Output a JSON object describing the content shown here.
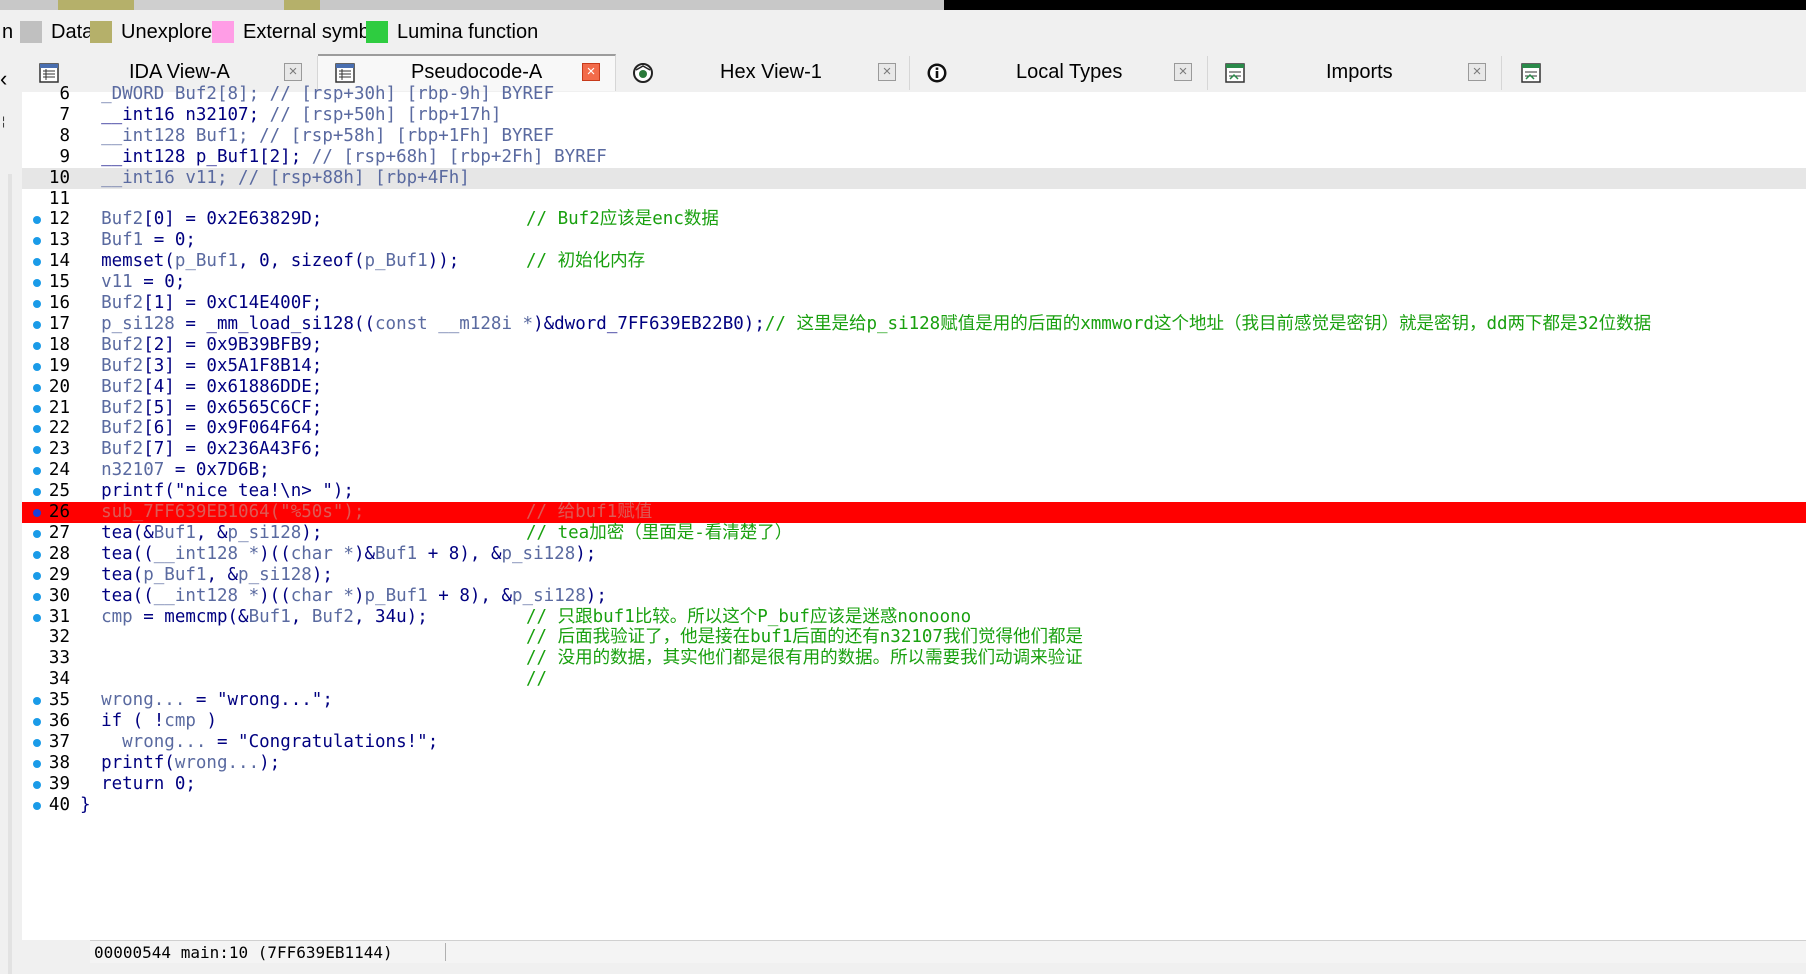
{
  "legend": [
    {
      "label": "n",
      "color": ""
    },
    {
      "label": "Data",
      "color": "#c0c0c0"
    },
    {
      "label": "Unexplored",
      "color": "#b5b06a"
    },
    {
      "label": "External symbol",
      "color": "#ff9de6"
    },
    {
      "label": "Lumina function",
      "color": "#2ecc40"
    }
  ],
  "tabs": [
    {
      "label": "IDA View-A",
      "icon": "grid-icon",
      "active": false
    },
    {
      "label": "Pseudocode-A",
      "icon": "grid-icon",
      "active": true
    },
    {
      "label": "Hex View-1",
      "icon": "hex-icon",
      "active": false
    },
    {
      "label": "Local Types",
      "icon": "info-icon",
      "active": false
    },
    {
      "label": "Imports",
      "icon": "imports-icon",
      "active": false
    }
  ],
  "code_lines": [
    {
      "no": "6",
      "bp": false,
      "tokens": [
        [
          "  _DWORD Buf2[8]; ",
          "t-dim"
        ],
        [
          "// [rsp+30h] [rbp-9h] BYREF",
          "t-dim"
        ]
      ]
    },
    {
      "no": "7",
      "bp": false,
      "tokens": [
        [
          "  __int16 n32107; ",
          "t-kw"
        ],
        [
          "// [rsp+50h] [rbp+17h]",
          "t-dim"
        ]
      ]
    },
    {
      "no": "8",
      "bp": false,
      "tokens": [
        [
          "  __int128 Buf1; ",
          "t-dim"
        ],
        [
          "// [rsp+58h] [rbp+1Fh] BYREF",
          "t-dim"
        ]
      ]
    },
    {
      "no": "9",
      "bp": false,
      "tokens": [
        [
          "  __int128 p_Buf1[2]; ",
          "t-kw"
        ],
        [
          "// [rsp+68h] [rbp+2Fh] BYREF",
          "t-dim"
        ]
      ]
    },
    {
      "no": "10",
      "bp": false,
      "current": true,
      "tokens": [
        [
          "  __int16 v11; ",
          "t-dim"
        ],
        [
          "// [rsp+88h] [rbp+4Fh]",
          "t-dim"
        ]
      ]
    },
    {
      "no": "11",
      "bp": false,
      "tokens": []
    },
    {
      "no": "12",
      "bp": true,
      "tokens": [
        [
          "  Buf2",
          "t-var"
        ],
        [
          "[0] = 0x2E63829D;",
          "t-kw"
        ]
      ],
      "comment": "// Buf2应该是enc数据"
    },
    {
      "no": "13",
      "bp": true,
      "tokens": [
        [
          "  Buf1",
          "t-var"
        ],
        [
          " = 0;",
          "t-kw"
        ]
      ]
    },
    {
      "no": "14",
      "bp": true,
      "tokens": [
        [
          "  memset(",
          "t-kw"
        ],
        [
          "p_Buf1",
          "t-var"
        ],
        [
          ", 0, sizeof(",
          "t-kw"
        ],
        [
          "p_Buf1",
          "t-var"
        ],
        [
          "));",
          "t-kw"
        ]
      ],
      "comment": "// 初始化内存"
    },
    {
      "no": "15",
      "bp": true,
      "tokens": [
        [
          "  v11",
          "t-var"
        ],
        [
          " = 0;",
          "t-kw"
        ]
      ]
    },
    {
      "no": "16",
      "bp": true,
      "tokens": [
        [
          "  Buf2",
          "t-var"
        ],
        [
          "[1] = 0xC14E400F;",
          "t-kw"
        ]
      ]
    },
    {
      "no": "17",
      "bp": true,
      "tokens": [
        [
          "  p_si128",
          "t-var"
        ],
        [
          " = _mm_load_si128((",
          "t-kw"
        ],
        [
          "const __m128i *",
          "t-dim"
        ],
        [
          ")&dword_7FF639EB22B0);",
          "t-kw"
        ],
        [
          "// 这里是给p_si128赋值是用的后面的xmmword这个地址（我目前感觉是密钥）就是密钥，dd两下都是32位数据",
          "t-cmt"
        ]
      ]
    },
    {
      "no": "18",
      "bp": true,
      "tokens": [
        [
          "  Buf2",
          "t-var"
        ],
        [
          "[2] = 0x9B39BFB9;",
          "t-kw"
        ]
      ]
    },
    {
      "no": "19",
      "bp": true,
      "tokens": [
        [
          "  Buf2",
          "t-var"
        ],
        [
          "[3] = 0x5A1F8B14;",
          "t-kw"
        ]
      ]
    },
    {
      "no": "20",
      "bp": true,
      "tokens": [
        [
          "  Buf2",
          "t-var"
        ],
        [
          "[4] = 0x61886DDE;",
          "t-kw"
        ]
      ]
    },
    {
      "no": "21",
      "bp": true,
      "tokens": [
        [
          "  Buf2",
          "t-var"
        ],
        [
          "[5] = 0x6565C6CF;",
          "t-kw"
        ]
      ]
    },
    {
      "no": "22",
      "bp": true,
      "tokens": [
        [
          "  Buf2",
          "t-var"
        ],
        [
          "[6] = 0x9F064F64;",
          "t-kw"
        ]
      ]
    },
    {
      "no": "23",
      "bp": true,
      "tokens": [
        [
          "  Buf2",
          "t-var"
        ],
        [
          "[7] = 0x236A43F6;",
          "t-kw"
        ]
      ]
    },
    {
      "no": "24",
      "bp": true,
      "tokens": [
        [
          "  n32107",
          "t-var"
        ],
        [
          " = 0x7D6B;",
          "t-kw"
        ]
      ]
    },
    {
      "no": "25",
      "bp": true,
      "tokens": [
        [
          "  printf(\"nice tea!\\n> \");",
          "t-kw"
        ]
      ]
    },
    {
      "no": "26",
      "bp": true,
      "breakpoint_line": true,
      "tokens": [
        [
          "  sub_7FF639EB1064(\"%50s\");",
          ""
        ]
      ],
      "comment": "// 给buf1赋值"
    },
    {
      "no": "27",
      "bp": true,
      "tokens": [
        [
          "  tea(&",
          "t-kw"
        ],
        [
          "Buf1",
          "t-var"
        ],
        [
          ", &",
          "t-kw"
        ],
        [
          "p_si128",
          "t-var"
        ],
        [
          ");",
          "t-kw"
        ]
      ],
      "comment": "// tea加密（里面是-看清楚了）"
    },
    {
      "no": "28",
      "bp": true,
      "tokens": [
        [
          "  tea((",
          "t-kw"
        ],
        [
          "__int128 *",
          "t-dim"
        ],
        [
          ")((",
          "t-kw"
        ],
        [
          "char *",
          "t-dim"
        ],
        [
          ")&",
          "t-kw"
        ],
        [
          "Buf1",
          "t-var"
        ],
        [
          " + 8), &",
          "t-kw"
        ],
        [
          "p_si128",
          "t-var"
        ],
        [
          ");",
          "t-kw"
        ]
      ]
    },
    {
      "no": "29",
      "bp": true,
      "tokens": [
        [
          "  tea(",
          "t-kw"
        ],
        [
          "p_Buf1",
          "t-var"
        ],
        [
          ", &",
          "t-kw"
        ],
        [
          "p_si128",
          "t-var"
        ],
        [
          ");",
          "t-kw"
        ]
      ]
    },
    {
      "no": "30",
      "bp": true,
      "tokens": [
        [
          "  tea((",
          "t-kw"
        ],
        [
          "__int128 *",
          "t-dim"
        ],
        [
          ")((",
          "t-kw"
        ],
        [
          "char *",
          "t-dim"
        ],
        [
          ")",
          "t-kw"
        ],
        [
          "p_Buf1",
          "t-var"
        ],
        [
          " + 8), &",
          "t-kw"
        ],
        [
          "p_si128",
          "t-var"
        ],
        [
          ");",
          "t-kw"
        ]
      ]
    },
    {
      "no": "31",
      "bp": true,
      "tokens": [
        [
          "  cmp",
          "t-var"
        ],
        [
          " = memcmp(&",
          "t-kw"
        ],
        [
          "Buf1",
          "t-var"
        ],
        [
          ", ",
          "t-kw"
        ],
        [
          "Buf2",
          "t-var"
        ],
        [
          ", 34u);",
          "t-kw"
        ]
      ],
      "comment": "// 只跟buf1比较。所以这个P_buf应该是迷惑nonoono"
    },
    {
      "no": "32",
      "bp": false,
      "tokens": [],
      "comment": "// 后面我验证了，他是接在buf1后面的还有n32107我们觉得他们都是"
    },
    {
      "no": "33",
      "bp": false,
      "tokens": [],
      "comment": "// 没用的数据，其实他们都是很有用的数据。所以需要我们动调来验证"
    },
    {
      "no": "34",
      "bp": false,
      "tokens": [],
      "comment": "//"
    },
    {
      "no": "35",
      "bp": true,
      "tokens": [
        [
          "  wrong...",
          "t-var"
        ],
        [
          " = \"wrong...\";",
          "t-kw"
        ]
      ]
    },
    {
      "no": "36",
      "bp": true,
      "tokens": [
        [
          "  if ( !",
          "t-kw"
        ],
        [
          "cmp",
          "t-var"
        ],
        [
          " )",
          "t-kw"
        ]
      ]
    },
    {
      "no": "37",
      "bp": true,
      "tokens": [
        [
          "    wrong...",
          "t-var"
        ],
        [
          " = \"Congratulations!\";",
          "t-kw"
        ]
      ]
    },
    {
      "no": "38",
      "bp": true,
      "tokens": [
        [
          "  printf(",
          "t-kw"
        ],
        [
          "wrong...",
          "t-var"
        ],
        [
          ");",
          "t-kw"
        ]
      ]
    },
    {
      "no": "39",
      "bp": true,
      "tokens": [
        [
          "  return 0;",
          "t-kw"
        ]
      ]
    },
    {
      "no": "40",
      "bp": true,
      "tokens": [
        [
          "}",
          "t-kw"
        ]
      ]
    }
  ],
  "status": {
    "text": "00000544 main:10 (7FF639EB1144)"
  },
  "colors": {
    "breakpoint_dot": "#1a9be8",
    "breakpoint_dot_active": "#1a3fd8",
    "breakpoint_bg": "#ff0000",
    "current_line_bg": "#e6e6e6",
    "comment": "#19a00f",
    "code": "#000080"
  }
}
